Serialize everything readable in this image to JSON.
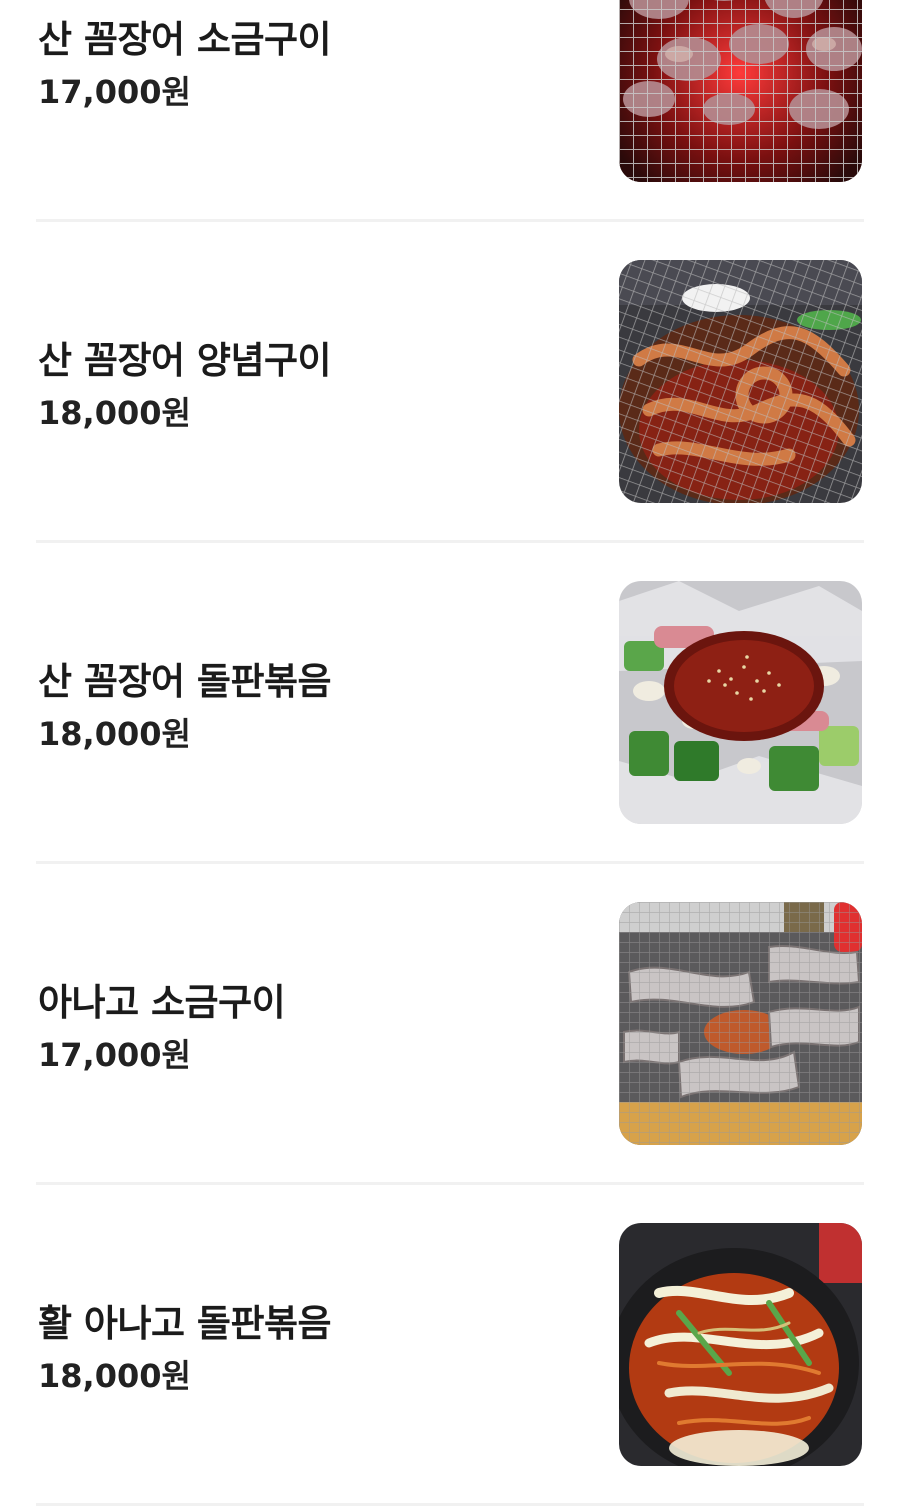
{
  "menu": {
    "items": [
      {
        "name": "산 꼼장어 소금구이",
        "price": "17,000원",
        "photo": "grilled-eel-salt-photo"
      },
      {
        "name": "산 꼼장어 양념구이",
        "price": "18,000원",
        "photo": "grilled-eel-seasoned-photo"
      },
      {
        "name": "산 꼼장어 돌판볶음",
        "price": "18,000원",
        "photo": "eel-stone-plate-stirfry-photo"
      },
      {
        "name": "아나고 소금구이",
        "price": "17,000원",
        "photo": "grilled-conger-salt-photo"
      },
      {
        "name": "활 아나고 돌판볶음",
        "price": "18,000원",
        "photo": "conger-stone-plate-stirfry-photo"
      }
    ]
  }
}
